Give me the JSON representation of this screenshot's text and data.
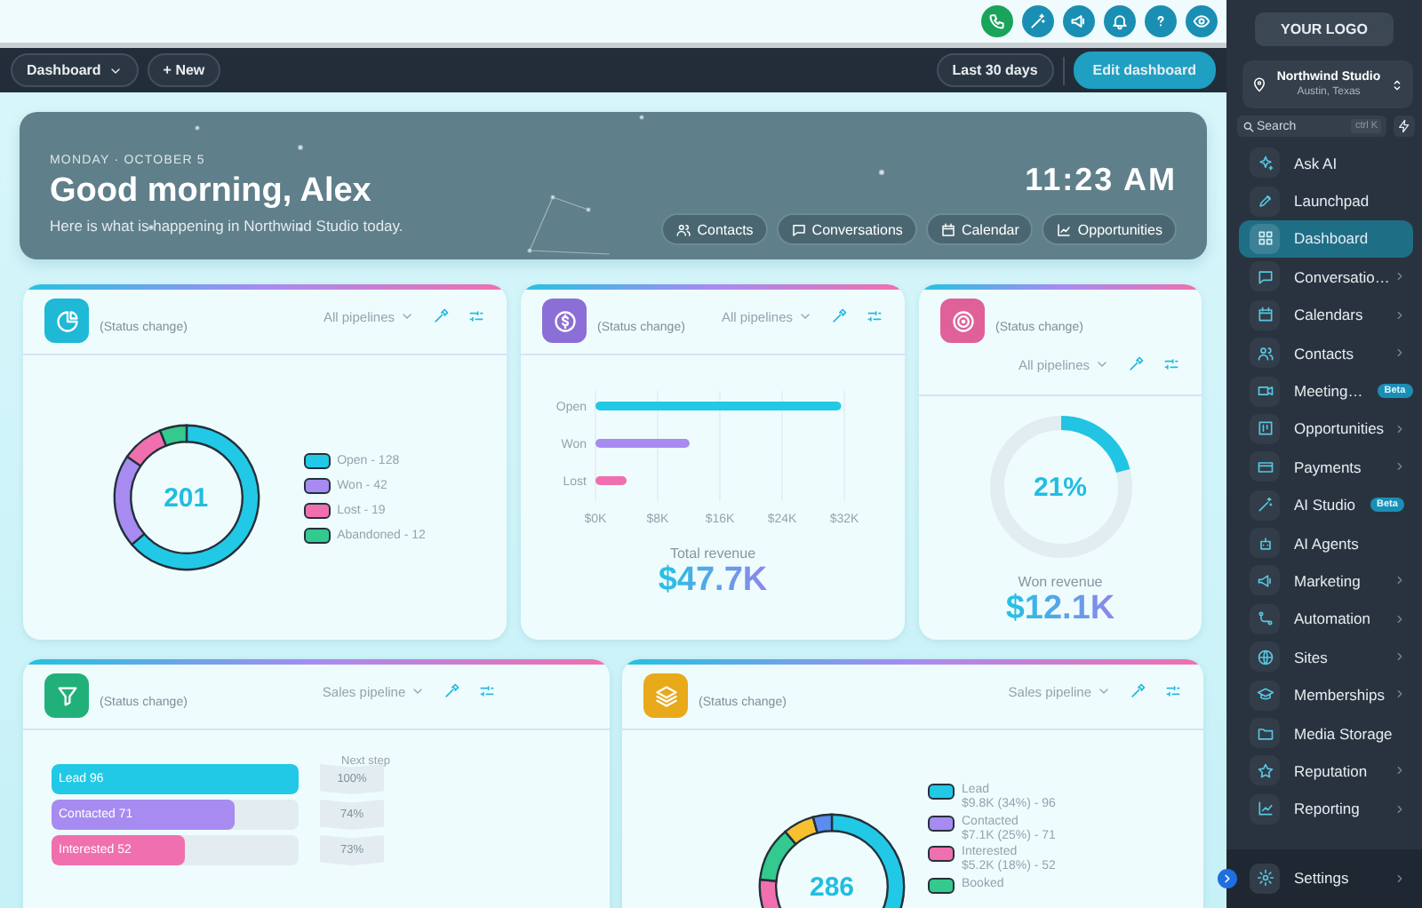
{
  "toolbar": {
    "dashboard_menu": "Dashboard",
    "new_button": "+ New",
    "date_range": "Last 30 days",
    "edit_button": "Edit dashboard"
  },
  "banner": {
    "date": "MONDAY · OCTOBER 5",
    "greeting": "Good morning, Alex",
    "subtitle": "Here is what is happening in Northwind Studio today.",
    "time": "11:23 AM",
    "shortcuts": [
      {
        "kind": "contacts",
        "label": "Contacts"
      },
      {
        "kind": "conversations",
        "label": "Conversations"
      },
      {
        "kind": "calendar",
        "label": "Calendar"
      },
      {
        "kind": "opportunities",
        "label": "Opportunities"
      }
    ]
  },
  "widgets": [
    {
      "kind": "donut",
      "color": "#1fb8d6",
      "subtitle": "(Status change)",
      "filter": "All pipelines",
      "total": "201",
      "chart_data": {
        "type": "donut",
        "categories": [
          "Open - 128",
          "Won - 42",
          "Lost - 19",
          "Abandoned - 12"
        ],
        "values": [
          63.7,
          20.9,
          9.4,
          6.0
        ]
      },
      "legend": [
        {
          "color": "#22c9e6"
        },
        {
          "color": "#a78bf0"
        },
        {
          "color": "#f06fae"
        },
        {
          "color": "#34c98e"
        }
      ]
    },
    {
      "kind": "bar",
      "color": "#8b6fd6",
      "subtitle": "(Status change)",
      "filter": "All pipelines",
      "bars": [
        {
          "color": "#22c9e6"
        },
        {
          "color": "#a78bf0"
        },
        {
          "color": "#f06fae"
        }
      ],
      "chart_data": {
        "type": "bar",
        "orientation": "horizontal",
        "grid": true,
        "categories": [
          "Open",
          "Won",
          "Lost"
        ],
        "values": [
          31.6,
          12.1,
          4.0
        ],
        "xlim": [
          0,
          32
        ],
        "xticks": [
          {
            "value": 0,
            "label": "$0K"
          },
          {
            "value": 8,
            "label": "$8K"
          },
          {
            "value": 16,
            "label": "$16K"
          },
          {
            "value": 24,
            "label": "$24K"
          },
          {
            "value": 32,
            "label": "$32K"
          }
        ]
      },
      "caption": "Total revenue",
      "amount": "$47.7K"
    },
    {
      "kind": "ring",
      "color": "#e0609a",
      "subtitle": "(Status change)",
      "filter": "All pipelines",
      "percent": "21%",
      "caption": "Won revenue",
      "amount": "$12.1K"
    },
    {
      "kind": "funnel",
      "color": "#22b07a",
      "subtitle": "(Status change)",
      "filter": "Sales pipeline",
      "column_label": "Next step",
      "stages": [
        {
          "label": "Lead 96",
          "level": 1,
          "color": "#22c9e6",
          "rate": "100%"
        },
        {
          "label": "Contacted 71",
          "level": 0.74,
          "color": "#a78bf0",
          "rate": "74%"
        },
        {
          "label": "Interested 52",
          "level": 0.54,
          "color": "#f06fae",
          "rate": "73%"
        }
      ]
    },
    {
      "kind": "breakdown",
      "color": "#e8a91a",
      "subtitle": "(Status change)",
      "filter": "Sales pipeline",
      "total": "286",
      "legend": [
        {
          "label": "Lead",
          "detail": "$9.8K (34%) - 96",
          "color": "#22c9e6"
        },
        {
          "label": "Contacted",
          "detail": "$7.1K (25%) - 71",
          "color": "#a78bf0"
        },
        {
          "label": "Interested",
          "detail": "$5.2K (18%) - 52",
          "color": "#f06fae"
        },
        {
          "label": "Booked",
          "color": "#34c98e"
        }
      ]
    }
  ],
  "sidebar": {
    "logo": "YOUR LOGO",
    "location": {
      "name": "Northwind Studio",
      "detail": "Austin, Texas"
    },
    "search": {
      "placeholder": "Search",
      "shortcut": "ctrl K"
    },
    "items": [
      {
        "label": "Ask AI",
        "selected": false,
        "expandable": false
      },
      {
        "label": "Launchpad",
        "selected": false,
        "expandable": false
      },
      {
        "label": "Dashboard",
        "selected": true,
        "expandable": false
      },
      {
        "label": "Conversatio…",
        "selected": false,
        "expandable": true
      },
      {
        "label": "Calendars",
        "selected": false,
        "expandable": true
      },
      {
        "label": "Contacts",
        "selected": false,
        "expandable": true
      },
      {
        "label": "Meeting…",
        "selected": false,
        "expandable": false,
        "badge": "Beta"
      },
      {
        "label": "Opportunities",
        "selected": false,
        "expandable": true
      },
      {
        "label": "Payments",
        "selected": false,
        "expandable": true
      },
      {
        "label": "AI Studio",
        "selected": false,
        "expandable": false,
        "badge": "Beta"
      },
      {
        "label": "AI Agents",
        "selected": false,
        "expandable": false
      },
      {
        "label": "Marketing",
        "selected": false,
        "expandable": true
      },
      {
        "label": "Automation",
        "selected": false,
        "expandable": true
      },
      {
        "label": "Sites",
        "selected": false,
        "expandable": true
      },
      {
        "label": "Memberships",
        "selected": false,
        "expandable": true
      },
      {
        "label": "Media Storage",
        "selected": false,
        "expandable": false
      },
      {
        "label": "Reputation",
        "selected": false,
        "expandable": true
      },
      {
        "label": "Reporting",
        "selected": false,
        "expandable": true
      }
    ],
    "footer": {
      "label": "Settings",
      "expandable": true
    }
  }
}
